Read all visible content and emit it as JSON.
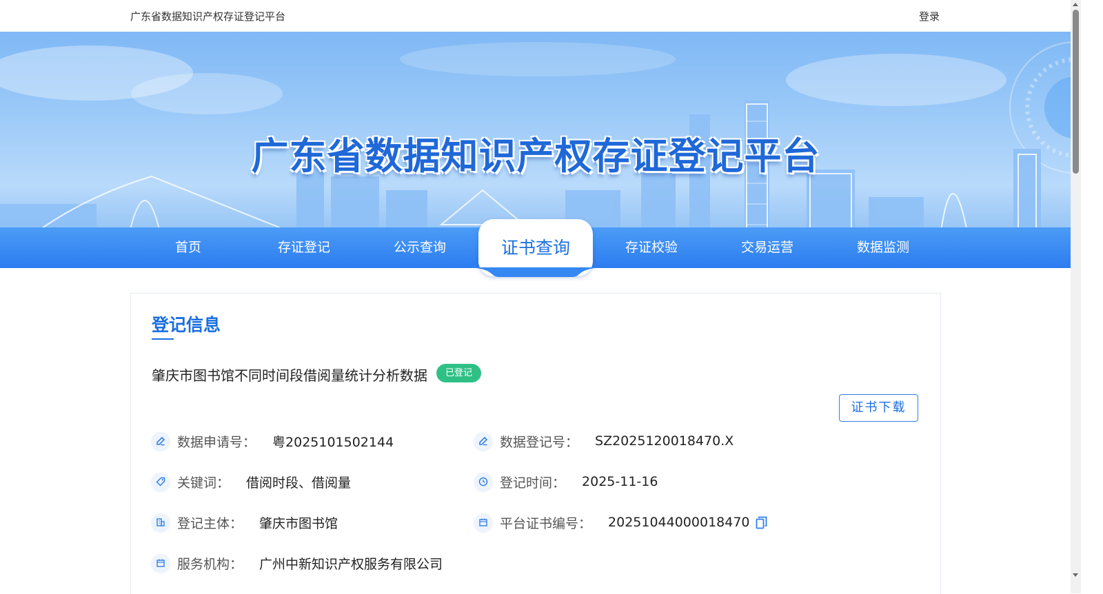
{
  "header": {
    "site_name": "广东省数据知识产权存证登记平台",
    "login_label": "登录"
  },
  "banner": {
    "title": "广东省数据知识产权存证登记平台"
  },
  "nav": {
    "items": [
      {
        "label": "首页",
        "active": false
      },
      {
        "label": "存证登记",
        "active": false
      },
      {
        "label": "公示查询",
        "active": false
      },
      {
        "label": "证书查询",
        "active": true
      },
      {
        "label": "存证校验",
        "active": false
      },
      {
        "label": "交易运营",
        "active": false
      },
      {
        "label": "数据监测",
        "active": false
      }
    ]
  },
  "record": {
    "section_title": "登记信息",
    "title": "肇庆市图书馆不同时间段借阅量统计分析数据",
    "status_badge": "已登记",
    "download_label": "证书下载",
    "fields": {
      "application_no": {
        "label": "数据申请号：",
        "value": "粤2025101502144",
        "icon": "edit-icon"
      },
      "registration_no": {
        "label": "数据登记号：",
        "value": "SZ2025120018470.X",
        "icon": "edit-icon"
      },
      "keywords": {
        "label": "关键词：",
        "value": "借阅时段、借阅量",
        "icon": "tag-icon"
      },
      "registration_time": {
        "label": "登记时间：",
        "value": "2025-11-16",
        "icon": "clock-icon"
      },
      "subject": {
        "label": "登记主体：",
        "value": "肇庆市图书馆",
        "icon": "building-icon"
      },
      "certificate_no": {
        "label": "平台证书编号：",
        "value": "20251044000018470",
        "icon": "calendar-icon"
      },
      "service_org": {
        "label": "服务机构：",
        "value": "广州中新知识产权服务有限公司",
        "icon": "calendar-icon"
      }
    }
  },
  "colors": {
    "primary": "#1a6fe0",
    "nav_bg": "#2c7cf0",
    "badge_green": "#2fc086"
  }
}
